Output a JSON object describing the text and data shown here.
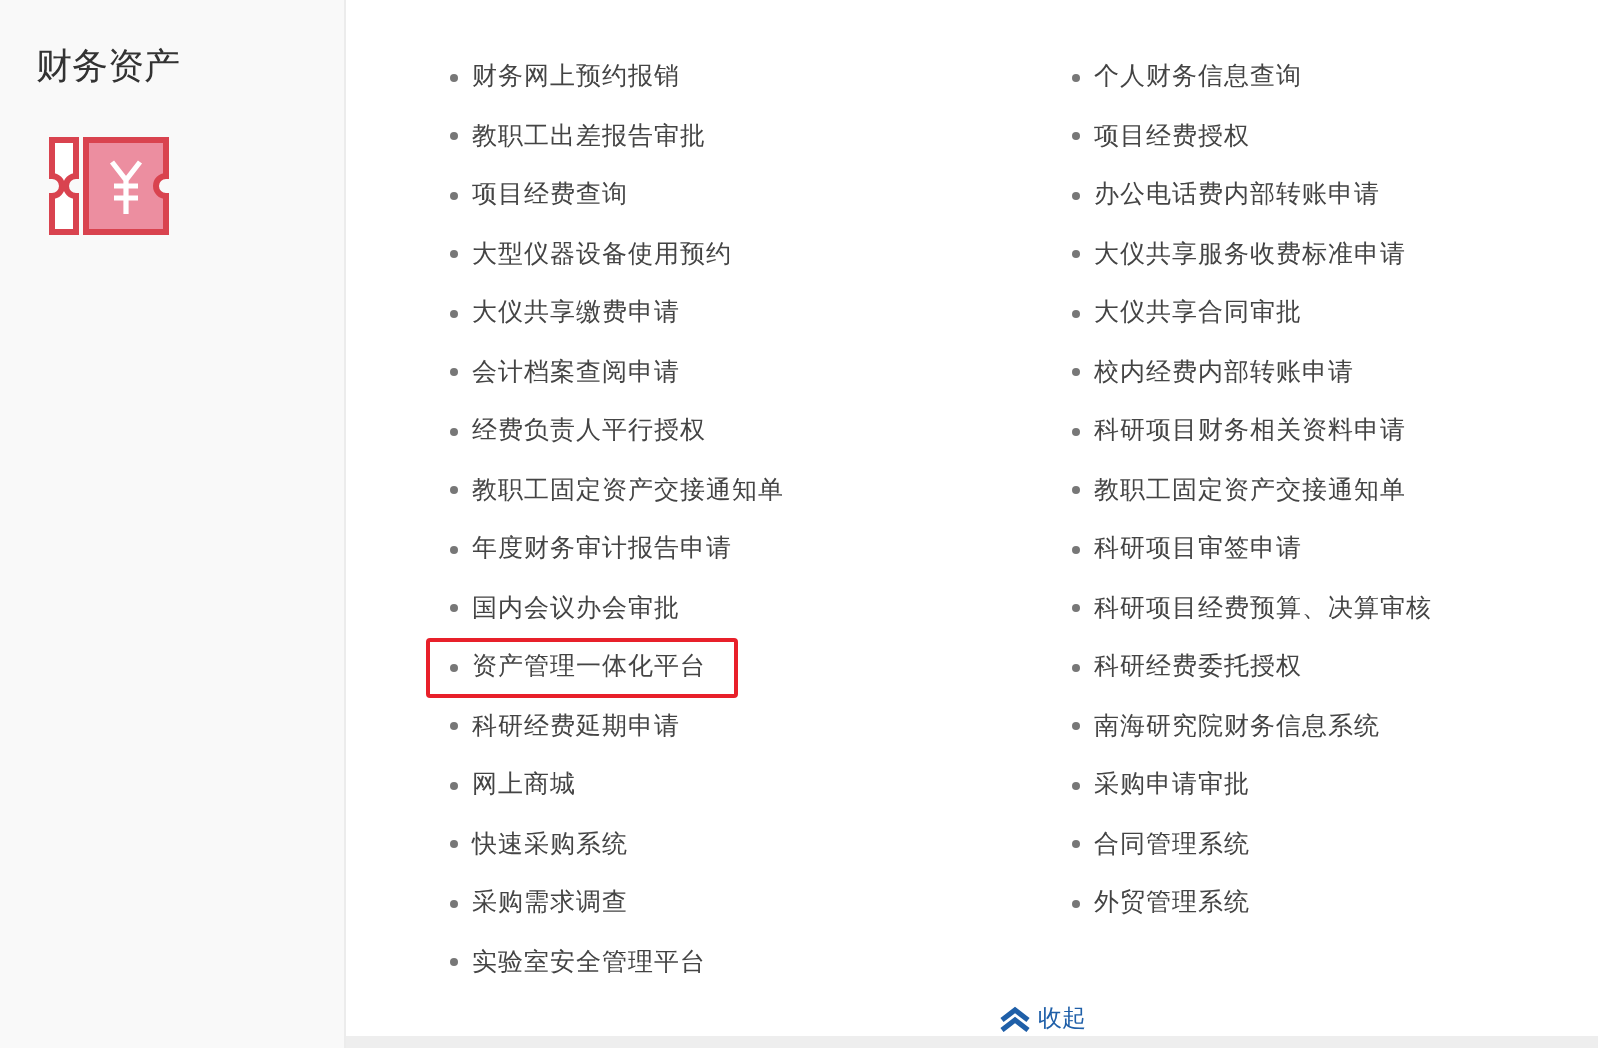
{
  "sidebar": {
    "title": "财务资产"
  },
  "link_columns": [
    [
      {
        "label": "财务网上预约报销",
        "highlighted": false
      },
      {
        "label": "教职工出差报告审批",
        "highlighted": false
      },
      {
        "label": "项目经费查询",
        "highlighted": false
      },
      {
        "label": "大型仪器设备使用预约",
        "highlighted": false
      },
      {
        "label": "大仪共享缴费申请",
        "highlighted": false
      },
      {
        "label": "会计档案查阅申请",
        "highlighted": false
      },
      {
        "label": "经费负责人平行授权",
        "highlighted": false
      },
      {
        "label": "教职工固定资产交接通知单",
        "highlighted": false
      },
      {
        "label": "年度财务审计报告申请",
        "highlighted": false
      },
      {
        "label": "国内会议办会审批",
        "highlighted": false
      },
      {
        "label": "资产管理一体化平台",
        "highlighted": true
      },
      {
        "label": "科研经费延期申请",
        "highlighted": false
      },
      {
        "label": "网上商城",
        "highlighted": false
      },
      {
        "label": "快速采购系统",
        "highlighted": false
      },
      {
        "label": "采购需求调查",
        "highlighted": false
      },
      {
        "label": "实验室安全管理平台",
        "highlighted": false
      }
    ],
    [
      {
        "label": "个人财务信息查询",
        "highlighted": false
      },
      {
        "label": "项目经费授权",
        "highlighted": false
      },
      {
        "label": "办公电话费内部转账申请",
        "highlighted": false
      },
      {
        "label": "大仪共享服务收费标准申请",
        "highlighted": false
      },
      {
        "label": "大仪共享合同审批",
        "highlighted": false
      },
      {
        "label": "校内经费内部转账申请",
        "highlighted": false
      },
      {
        "label": "科研项目财务相关资料申请",
        "highlighted": false
      },
      {
        "label": "教职工固定资产交接通知单",
        "highlighted": false
      },
      {
        "label": "科研项目审签申请",
        "highlighted": false
      },
      {
        "label": "科研项目经费预算、决算审核",
        "highlighted": false
      },
      {
        "label": "科研经费委托授权",
        "highlighted": false
      },
      {
        "label": "南海研究院财务信息系统",
        "highlighted": false
      },
      {
        "label": "采购申请审批",
        "highlighted": false
      },
      {
        "label": "合同管理系统",
        "highlighted": false
      },
      {
        "label": "外贸管理系统",
        "highlighted": false
      }
    ]
  ],
  "collapse_link": {
    "label": "收起"
  }
}
